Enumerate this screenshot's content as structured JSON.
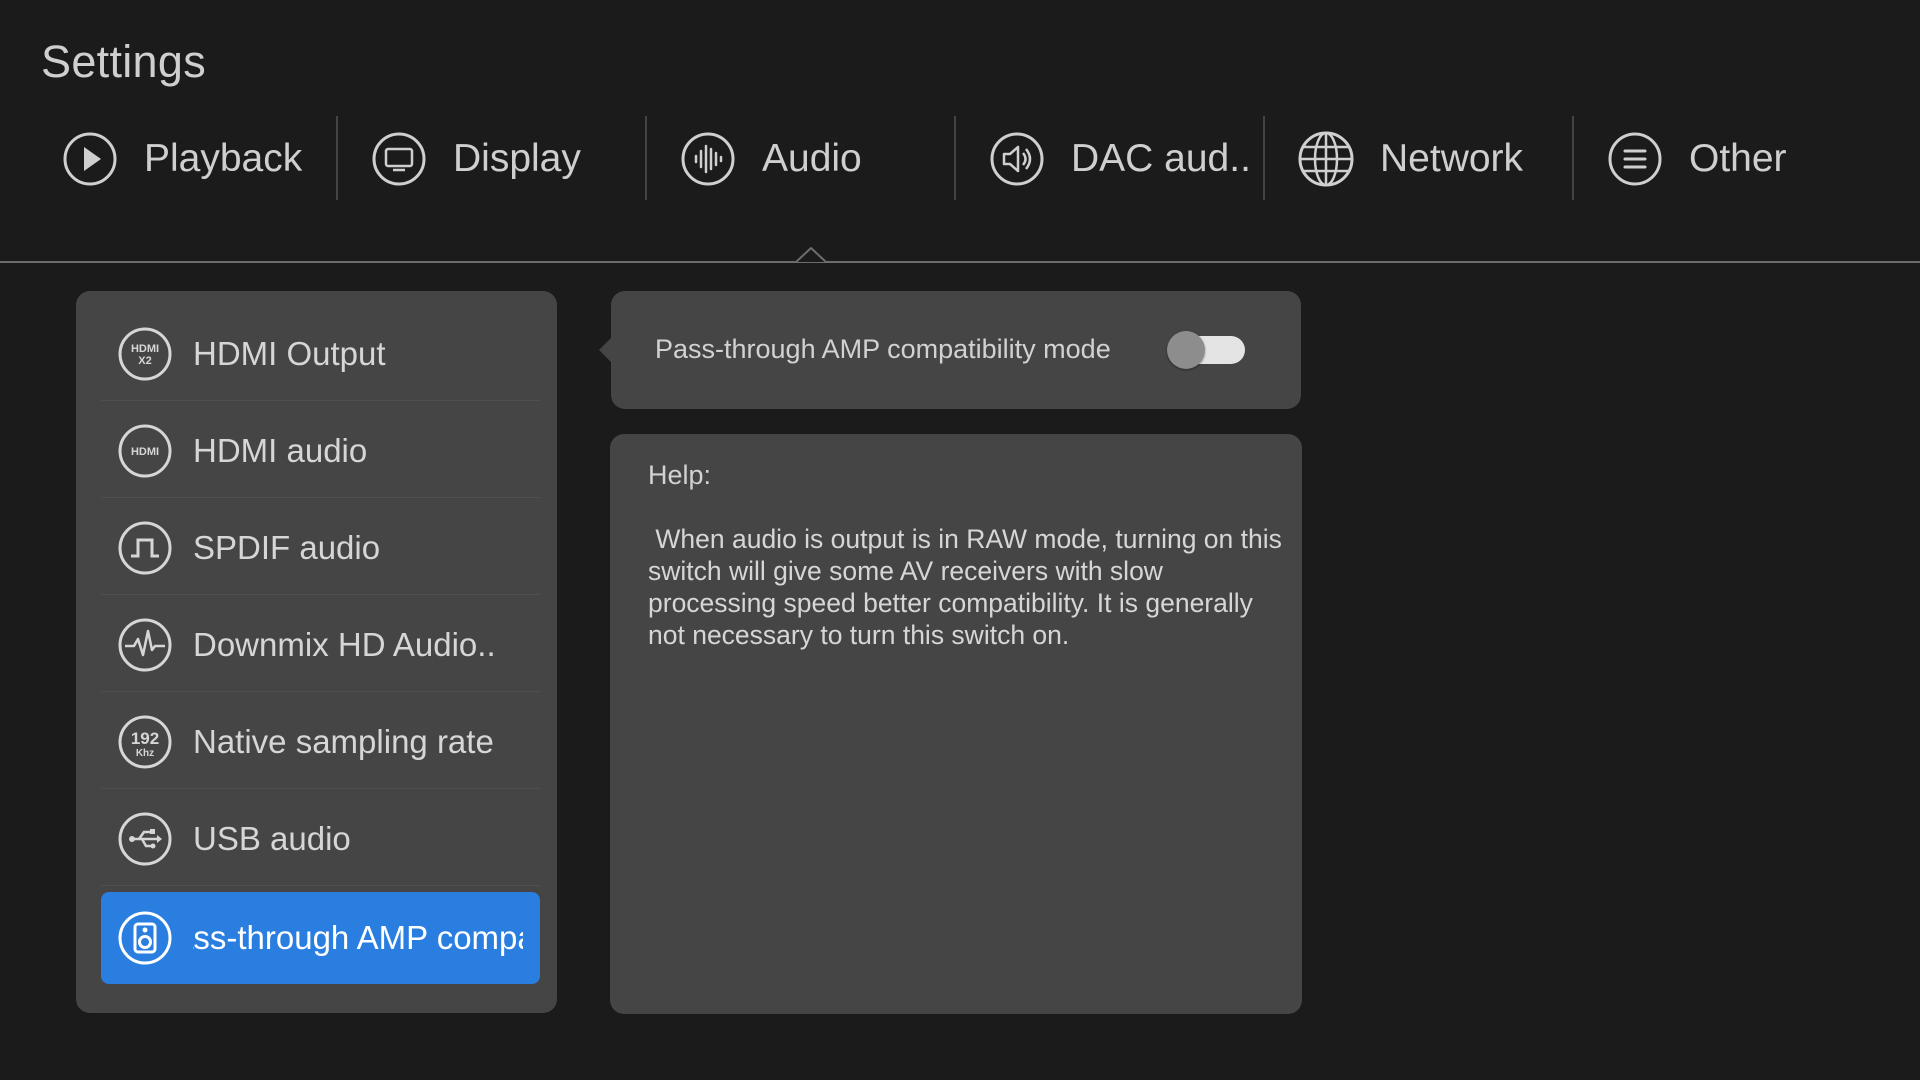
{
  "header": {
    "title": "Settings"
  },
  "tabs": [
    {
      "label": "Playback",
      "icon": "play-icon"
    },
    {
      "label": "Display",
      "icon": "monitor-icon"
    },
    {
      "label": "Audio",
      "icon": "audio-waveform-icon",
      "selected": true
    },
    {
      "label": "DAC aud..",
      "icon": "speaker-icon"
    },
    {
      "label": "Network",
      "icon": "globe-icon"
    },
    {
      "label": "Other",
      "icon": "menu-icon"
    }
  ],
  "audio_menu": {
    "items": [
      {
        "label": "HDMI Output",
        "icon": "hdmi-x2-icon"
      },
      {
        "label": "HDMI audio",
        "icon": "hdmi-icon"
      },
      {
        "label": "SPDIF audio",
        "icon": "spdif-pulse-icon"
      },
      {
        "label": "Downmix HD Audio..",
        "icon": "heartbeat-icon"
      },
      {
        "label": "Native sampling rate",
        "icon": "192khz-icon"
      },
      {
        "label": "USB audio",
        "icon": "usb-icon"
      },
      {
        "label": "Pass-through AMP compatibility mode",
        "icon": "amp-speaker-icon",
        "selected": true
      }
    ]
  },
  "setting": {
    "label": "Pass-through AMP compatibility mode",
    "toggle_on": false
  },
  "help": {
    "title": "Help:",
    "text": " When audio is output is in RAW mode, turning on this switch will give some AV receivers with slow processing speed better compatibility. It is generally not necessary to turn this switch on."
  },
  "colors": {
    "background": "#1b1b1c",
    "panel": "#454546",
    "accent": "#2a7ee0",
    "text": "#d2d2d2"
  }
}
